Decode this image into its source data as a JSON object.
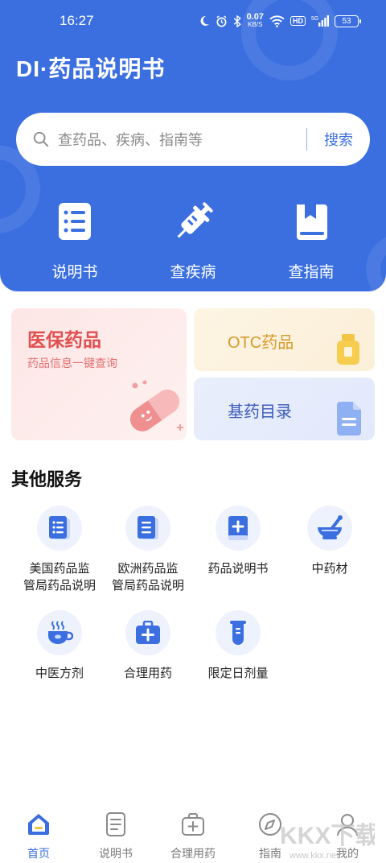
{
  "status_bar": {
    "time": "16:27",
    "net_speed": "0.07",
    "net_unit": "KB/S",
    "hd": "HD",
    "signal": "5G",
    "battery": "53"
  },
  "app_title": "DI·药品说明书",
  "search": {
    "placeholder": "查药品、疾病、指南等",
    "button": "搜索"
  },
  "quick_actions": [
    {
      "label": "说明书",
      "icon": "document-list-icon"
    },
    {
      "label": "查疾病",
      "icon": "syringe-icon"
    },
    {
      "label": "查指南",
      "icon": "book-icon"
    }
  ],
  "cards": {
    "yibao": {
      "title": "医保药品",
      "subtitle": "药品信息一键查询",
      "icon": "pill-capsule-icon"
    },
    "otc": {
      "title": "OTC药品",
      "icon": "medicine-bottle-icon"
    },
    "jiyao": {
      "title": "基药目录",
      "icon": "file-icon"
    }
  },
  "other_services": {
    "title": "其他服务",
    "items": [
      {
        "label_line1": "美国药品监",
        "label_line2": "管局药品说明",
        "icon": "document-list-icon"
      },
      {
        "label_line1": "欧洲药品监",
        "label_line2": "管局药品说明",
        "icon": "document-icon"
      },
      {
        "label_line1": "药品说明书",
        "label_line2": "",
        "icon": "medical-book-icon"
      },
      {
        "label_line1": "中药材",
        "label_line2": "",
        "icon": "mortar-pestle-icon"
      },
      {
        "label_line1": "中医方剂",
        "label_line2": "",
        "icon": "herbal-cup-icon"
      },
      {
        "label_line1": "合理用药",
        "label_line2": "",
        "icon": "medical-kit-icon"
      },
      {
        "label_line1": "限定日剂量",
        "label_line2": "",
        "icon": "test-tube-icon"
      }
    ]
  },
  "bottom_nav": [
    {
      "label": "首页",
      "icon": "home-icon",
      "active": true
    },
    {
      "label": "说明书",
      "icon": "document-icon",
      "active": false
    },
    {
      "label": "合理用药",
      "icon": "medical-kit-icon",
      "active": false
    },
    {
      "label": "指南",
      "icon": "compass-icon",
      "active": false
    },
    {
      "label": "我的",
      "icon": "user-icon",
      "active": false
    }
  ],
  "watermark": {
    "text": "KKX下载",
    "url_text": "www.kkx.net"
  },
  "colors": {
    "primary": "#3b6fe0",
    "yibao_red": "#e05050",
    "otc_gold": "#d69a2a",
    "jiyao_blue": "#3a5bb8"
  }
}
